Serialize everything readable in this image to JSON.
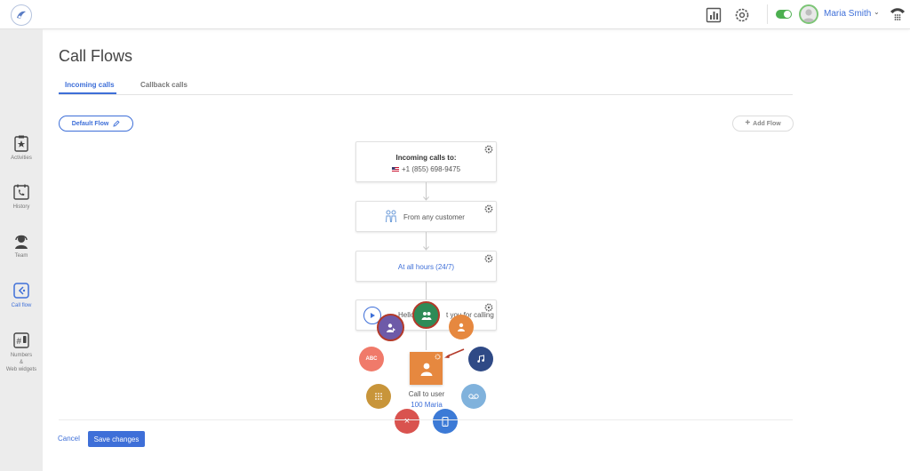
{
  "header": {
    "user_name": "Maria Smith",
    "icons": [
      "app-logo",
      "stats-icon",
      "settings-gear-icon",
      "status-toggle",
      "user-avatar",
      "chevron-down-icon",
      "phone-dialpad-icon"
    ],
    "status_toggle_on": true
  },
  "sidebar": {
    "items": [
      {
        "label": "Activities",
        "icon": "star-clipboard-icon"
      },
      {
        "label": "History",
        "icon": "phone-calendar-icon"
      },
      {
        "label": "Team",
        "icon": "headset-agent-icon"
      },
      {
        "label": "Call flow",
        "icon": "call-flow-icon",
        "active": true
      },
      {
        "label_lines": [
          "Numbers",
          "&",
          "Web widgets"
        ],
        "icon": "hash-phone-icon"
      }
    ]
  },
  "main": {
    "title": "Call Flows",
    "tabs": [
      {
        "label": "Incoming calls",
        "active": true
      },
      {
        "label": "Callback calls",
        "active": false
      }
    ],
    "flow_selector": {
      "label": "Default Flow",
      "icon": "pencil-icon"
    },
    "add_flow_label": "Add Flow",
    "flow": {
      "incoming_title": "Incoming calls to:",
      "incoming_number": "+1 (855) 698-9475",
      "customer_filter": "From any customer",
      "schedule": "At all hours (24/7)",
      "greeting_partial_left": "Hello a",
      "greeting_partial_right": "t you for calling",
      "call_to_user_label": "Call to user",
      "call_to_user_value": "100 Maria"
    },
    "picker_icons": [
      "ivr-group-icon",
      "forward-person-icon",
      "user-icon",
      "abc-text-icon",
      "music-icon",
      "dialpad-icon",
      "voicemail-icon",
      "close-icon",
      "mobile-phone-icon"
    ],
    "colors": {
      "accent": "#3e6fd8",
      "green": "#2e8b57",
      "purple": "#6e5aa8",
      "orange": "#e6883f",
      "salmon": "#f07a6a",
      "navy": "#2f4a86",
      "gold": "#c8953a",
      "lightblue": "#80b2dc",
      "red": "#d9534f",
      "blue": "#3c7ad6"
    }
  },
  "footer": {
    "cancel_label": "Cancel",
    "save_label": "Save changes"
  }
}
